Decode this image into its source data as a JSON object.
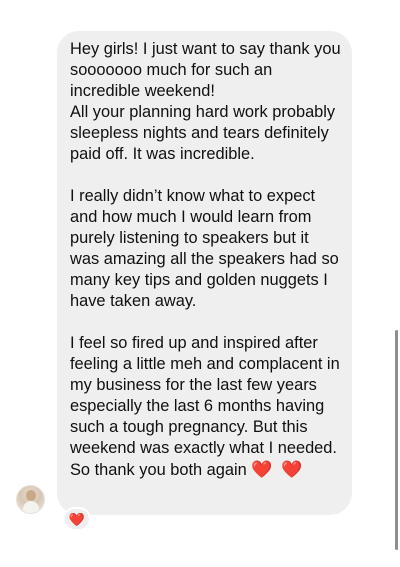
{
  "message": {
    "paragraph_1_greeting": "Hey girls! I just want to say thank you sooooooo much for such an incredible weekend!",
    "paragraph_1_rest": "All your planning hard work probably sleepless nights and tears definitely paid off. It was incredible.",
    "paragraph_2": "I really didn’t know what to expect and how much I would learn from purely listening to speakers but it was amazing all the speakers had so many key tips and golden nuggets I have taken away.",
    "paragraph_3": "I feel so fired up and inspired after feeling a little meh and complacent in my business for the last few years especially the last 6 months having such a tough pregnancy. But this weekend was exactly what I needed.",
    "closing_text": "So thank you both again",
    "closing_hearts": "❤️ ❤️"
  },
  "reaction": {
    "emoji": "❤️"
  },
  "colors": {
    "bubble_background": "#efefef",
    "text": "#101010",
    "heart": "#e0203a"
  },
  "icons": {
    "avatar": "sender-avatar",
    "reaction": "heart-reaction-icon"
  }
}
